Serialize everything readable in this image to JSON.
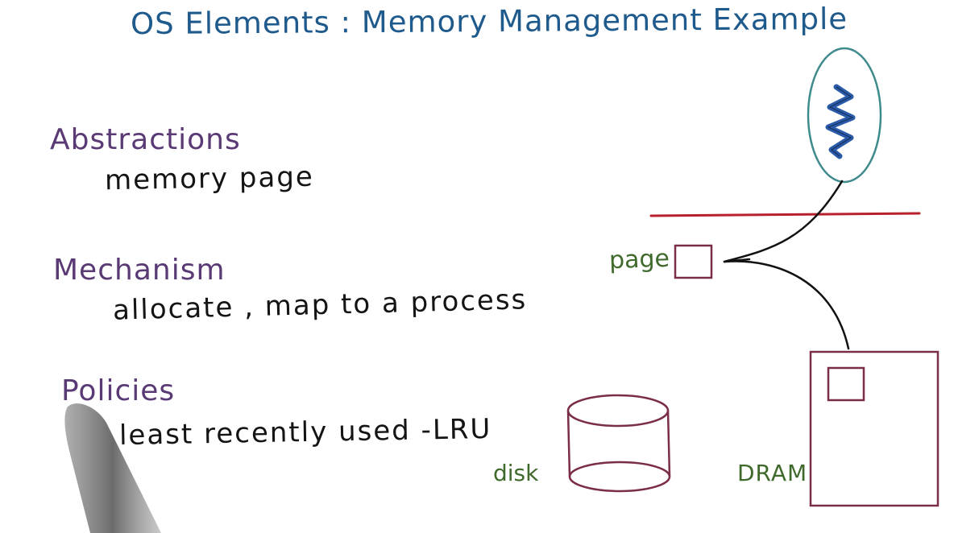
{
  "title": "OS Elements : Memory Management Example",
  "sections": [
    {
      "heading": "Abstractions",
      "text": "memory page"
    },
    {
      "heading": "Mechanism",
      "text": "allocate , map to a process"
    },
    {
      "heading": "Policies",
      "text": "least recently used -LRU"
    }
  ],
  "diagram": {
    "page_label": "page",
    "disk_label": "disk",
    "dram_label": "DRAM"
  },
  "colors": {
    "title": "#1f5a8c",
    "heading": "#5a3a74",
    "body": "#141414",
    "label": "#3f6a2c",
    "shape": "#7a2c48",
    "divider": "#b8202c",
    "process_outline": "#3f8a8c",
    "process_thread": "#2a5aa8"
  }
}
